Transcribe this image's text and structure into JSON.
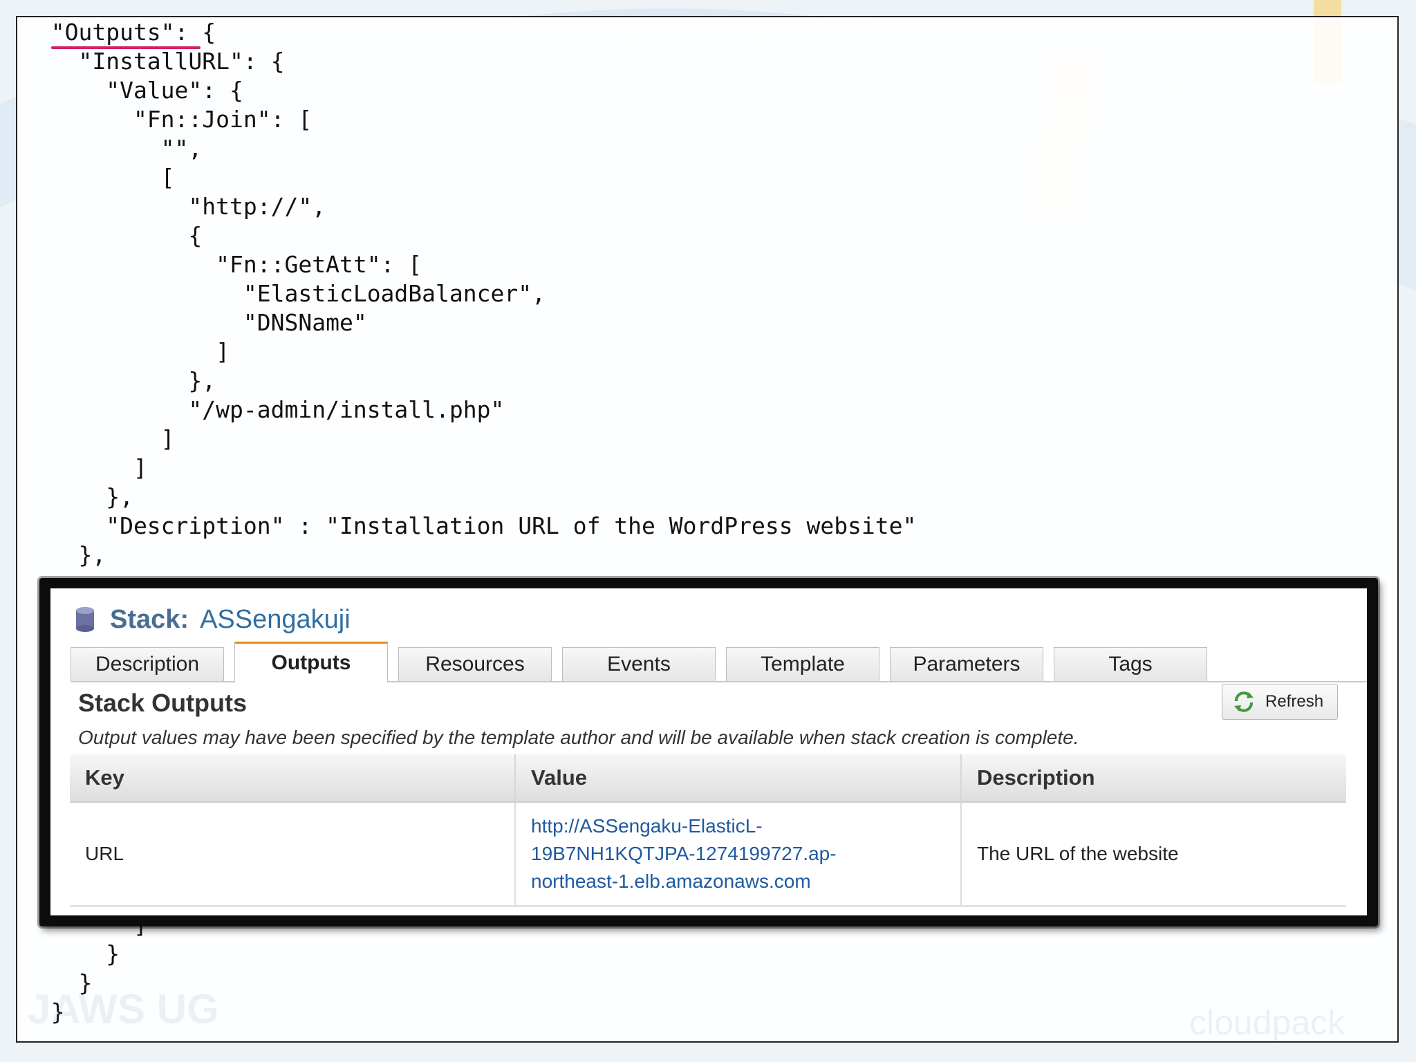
{
  "code": {
    "top_lines": [
      "  \"Outputs\": {",
      "    \"InstallURL\": {",
      "      \"Value\": {",
      "        \"Fn::Join\": [",
      "          \"\",",
      "          [",
      "            \"http://\",",
      "            {",
      "              \"Fn::GetAtt\": [",
      "                \"ElasticLoadBalancer\",",
      "                \"DNSName\"",
      "              ]",
      "            },",
      "            \"/wp-admin/install.php\"",
      "          ]",
      "        ]",
      "      },",
      "      \"Description\" : \"Installation URL of the WordPress website\"",
      "    },"
    ],
    "bottom_lines": [
      "        ]",
      "      }",
      "    }",
      "  }"
    ]
  },
  "watermarks": {
    "left": "JAWS UG",
    "right": "cloudpack"
  },
  "stack": {
    "label": "Stack:",
    "name": "ASSengakuji"
  },
  "tabs": [
    {
      "label": "Description",
      "active": false
    },
    {
      "label": "Outputs",
      "active": true
    },
    {
      "label": "Resources",
      "active": false
    },
    {
      "label": "Events",
      "active": false
    },
    {
      "label": "Template",
      "active": false
    },
    {
      "label": "Parameters",
      "active": false
    },
    {
      "label": "Tags",
      "active": false
    }
  ],
  "outputs": {
    "title": "Stack Outputs",
    "description": "Output values may have been specified by the template author and will be available when stack creation is complete.",
    "refresh_label": "Refresh",
    "columns": [
      "Key",
      "Value",
      "Description"
    ],
    "rows": [
      {
        "key": "URL",
        "value_lines": [
          "http://ASSengaku-ElasticL-",
          "19B7NH1KQTJPA-1274199727.ap-",
          "northeast-1.elb.amazonaws.com"
        ],
        "description": "The URL of the website"
      }
    ]
  },
  "colors": {
    "accent_underline": "#d61f66",
    "active_tab_top": "#e58a1f",
    "link": "#1f5aa0",
    "stack_name": "#2f6ea2"
  },
  "icons": {
    "stack": "database-icon",
    "refresh": "refresh-icon"
  }
}
